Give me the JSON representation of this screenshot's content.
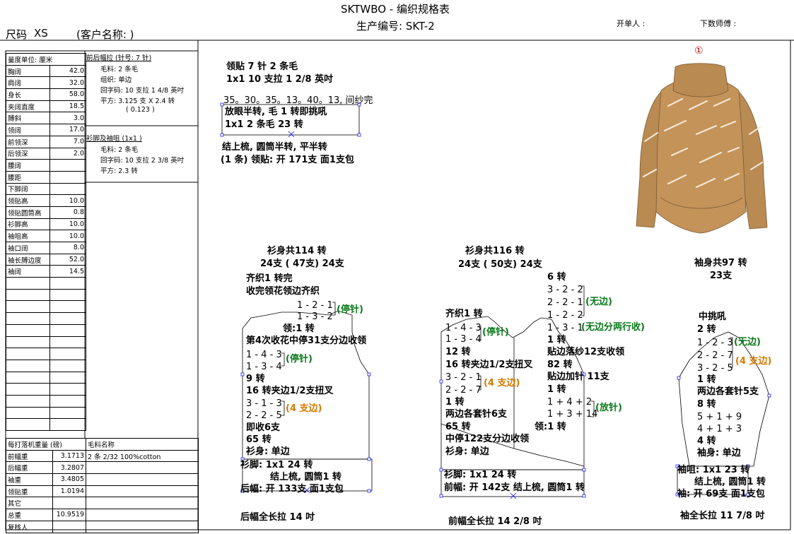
{
  "header": {
    "title": "SKTWBO - 编织规格表",
    "size_label": "尺码",
    "size_value": "XS",
    "customer_label": "(客户名称: )",
    "product_no": "生产编号: SKT-2",
    "issuer": "开单人 :",
    "master": "下数师傅 :"
  },
  "measurements": {
    "unit": "量度单位: 厘米",
    "rows": [
      {
        "name": "胸阔",
        "value": "42.0"
      },
      {
        "name": "肩阔",
        "value": "32.0"
      },
      {
        "name": "身长",
        "value": "58.0"
      },
      {
        "name": "夹阔直度",
        "value": "18.5"
      },
      {
        "name": "膊斜",
        "value": "3.0"
      },
      {
        "name": "领阔",
        "value": "17.0"
      },
      {
        "name": "前领深",
        "value": "7.0"
      },
      {
        "name": "后领深",
        "value": "2.0"
      },
      {
        "name": "腰阔",
        "value": ""
      },
      {
        "name": "腰距",
        "value": ""
      },
      {
        "name": "下脚阔",
        "value": ""
      },
      {
        "name": "领贴高",
        "value": "10.0"
      },
      {
        "name": "领贴圆筒高",
        "value": "0.8"
      },
      {
        "name": "衫脚高",
        "value": "10.0"
      },
      {
        "name": "袖咀高",
        "value": "10.0"
      },
      {
        "name": "袖口阔",
        "value": "8.0"
      },
      {
        "name": "袖长膊边度",
        "value": "52.0"
      },
      {
        "name": "袖阔",
        "value": "14.5"
      }
    ]
  },
  "spec": {
    "front_back_title": "前后幅拉 (针号: 7 针)",
    "fb_lines": [
      "毛料: 2 条毛",
      "组织: 单边",
      "回字码: 10 支拉 1 4/8 英吋",
      "平方: 3.125 支 X 2.4 转",
      "( 0.123 )"
    ],
    "hem_title": "衫脚及袖咀 (1x1 )",
    "hem_lines": [
      "毛料: 2 条毛",
      "回字码: 10 支拉 2 3/8 英吋",
      "平方: 2.3 转"
    ]
  },
  "weights": {
    "title": "每打落机重量 (磅)",
    "material_title": "毛料名称",
    "material_value": "2 条 2/32 100%cotton",
    "rows": [
      {
        "name": "前幅重",
        "value": "3.1713"
      },
      {
        "name": "后幅重",
        "value": "3.2807"
      },
      {
        "name": "袖重",
        "value": "3.4805"
      },
      {
        "name": "领贴重",
        "value": "1.0194"
      },
      {
        "name": "其它",
        "value": ""
      },
      {
        "name": "总重",
        "value": "10.9519"
      },
      {
        "name": "复核人",
        "value": ""
      }
    ]
  },
  "collar": {
    "l1": "领贴 7 针 2 条毛",
    "l2": "1x1  10 支拉 1 2/8 英吋",
    "l3": "35。30。35。13。40。13, 间纱完",
    "l4": "放眼半转, 毛 1 转即挑吼",
    "l5": "1x1  2 条毛    23 转",
    "l6": "结上梳, 圆筒半转, 平半转",
    "l7": "(1 条) 领贴: 开 171支 面1支包"
  },
  "back": {
    "t1": "衫身共114 转",
    "t2": "24支 ( 47支) 24支",
    "a1": "齐织1 转完",
    "a2": "收完领花领边齐织",
    "a3": "1 - 2 - 1",
    "a4": "1 - 3 - 2",
    "a4g": "(停针)",
    "a5": "领:1 转",
    "a6": "第4次收花中停31支分边收领",
    "a7": "1 - 4 - 3",
    "a8": "1 - 3 - 4",
    "a8g": "(停针)",
    "a9": "9 转",
    "a10": "16 转夹边1/2支扭叉",
    "a11": "3 - 1 - 3",
    "a12": "2 - 2 - 5",
    "a12o": "(4 支边)",
    "a13": "即收6支",
    "a14": "65 转",
    "a15": "衫身: 单边",
    "a16": "衫脚: 1x1    24 转",
    "a17": "结上梳, 圆筒1 转",
    "a18": "后幅: 开 133支 面1支包",
    "bottom": "后幅全长拉 14 吋"
  },
  "front": {
    "t1": "衫身共116 转",
    "t2": "24支 ( 50支) 24支",
    "b1": "齐织1 转",
    "b2": "1 - 4 - 3",
    "b3": "1 - 3 - 4",
    "b3g": "(停针)",
    "b4": "12 转",
    "b5": "16 转夹边1/2支扭叉",
    "b6": "3 - 2 - 1",
    "b7": "2 - 2 - 7",
    "b7o": "(4 支边)",
    "b8": "1 转",
    "b9": "两边各套针6支",
    "b10": "65 转",
    "b11": "中停122支分边收领",
    "b12": "衫身: 单边",
    "b13": "衫脚: 1x1    24 转",
    "b14": "前幅: 开 142支 结上梳, 圆筒1 转",
    "r1": "6 转",
    "r2": "3 - 2 - 2",
    "r3": "2 - 2 - 1",
    "r4": "1 - 2 - 2",
    "r4g": "(无边)",
    "r5": "1 - 3 - 1",
    "r5g": "(无边分两行收)",
    "r6": "1 转",
    "r7": "贴边落纱12支收领",
    "r8": "82 转",
    "r9": "贴边加针 11支",
    "r10": "1 转",
    "r11": "1 + 4 + 2",
    "r12": "1 + 3 + 14",
    "r12g": "(放针)",
    "r13": "领:1 转",
    "bottom": "前幅全长拉 14 2/8 吋"
  },
  "sleeve": {
    "t1": "袖身共97 转",
    "t2": "23支",
    "c1": "中挑吼",
    "c2": "2 转",
    "c3": "1 - 2 - 3",
    "c3g": "(无边)",
    "c4": "2 - 2 - 7",
    "c5": "3 - 2 - 5",
    "c5o": "(4 支边)",
    "c6": "1 转",
    "c7": "两边各套针5支",
    "c8": "8 转",
    "c9": "5 + 1 + 9",
    "c10": "4 + 1 + 3",
    "c11": "4 转",
    "c12": "袖身: 单边",
    "c13": "袖咀: 1x1    23 转",
    "c14": "结上梳, 圆筒1 转",
    "c15": "袖: 开 69支 面1支包",
    "bottom": "袖全长拉 11 7/8 吋"
  },
  "illustration": {
    "marker": "①",
    "sweater_color": "#c4935a"
  }
}
